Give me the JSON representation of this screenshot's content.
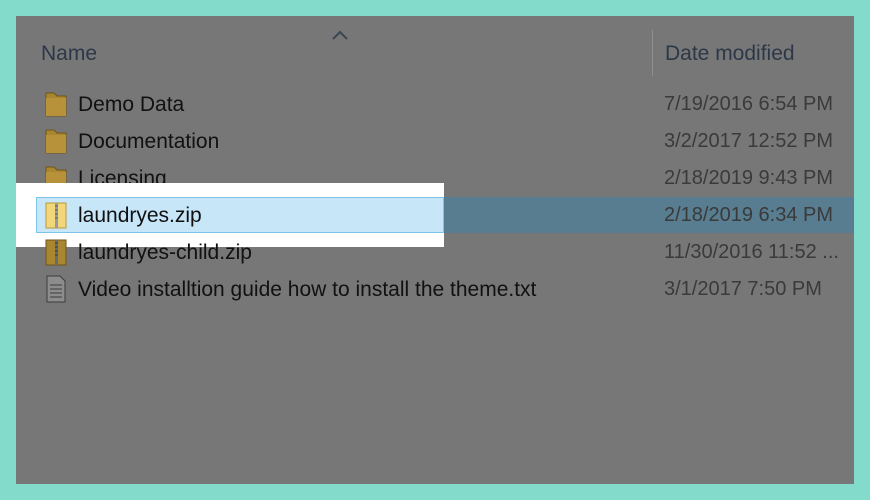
{
  "columns": {
    "name": "Name",
    "date_modified": "Date modified"
  },
  "files": [
    {
      "name": "Demo Data",
      "date": "7/19/2016 6:54 PM",
      "icon": "folder-icon"
    },
    {
      "name": "Documentation",
      "date": "3/2/2017 12:52 PM",
      "icon": "folder-icon"
    },
    {
      "name": "Licensing",
      "date": "2/18/2019 9:43 PM",
      "icon": "folder-icon"
    },
    {
      "name": "laundryes.zip",
      "date": "2/18/2019 6:34 PM",
      "icon": "zip-folder-icon",
      "selected": true
    },
    {
      "name": "laundryes-child.zip",
      "date": "11/30/2016 11:52 ...",
      "icon": "zip-folder-icon"
    },
    {
      "name": "Video installtion guide how to install the theme.txt",
      "date": "3/1/2017 7:50 PM",
      "icon": "text-file-icon"
    }
  ],
  "colors": {
    "frame": "#83dbcb",
    "panel_dimmed": "#777777",
    "selection": "#c7e6f8",
    "selection_dimmed": "#587d90",
    "highlight": "#ffffff"
  }
}
